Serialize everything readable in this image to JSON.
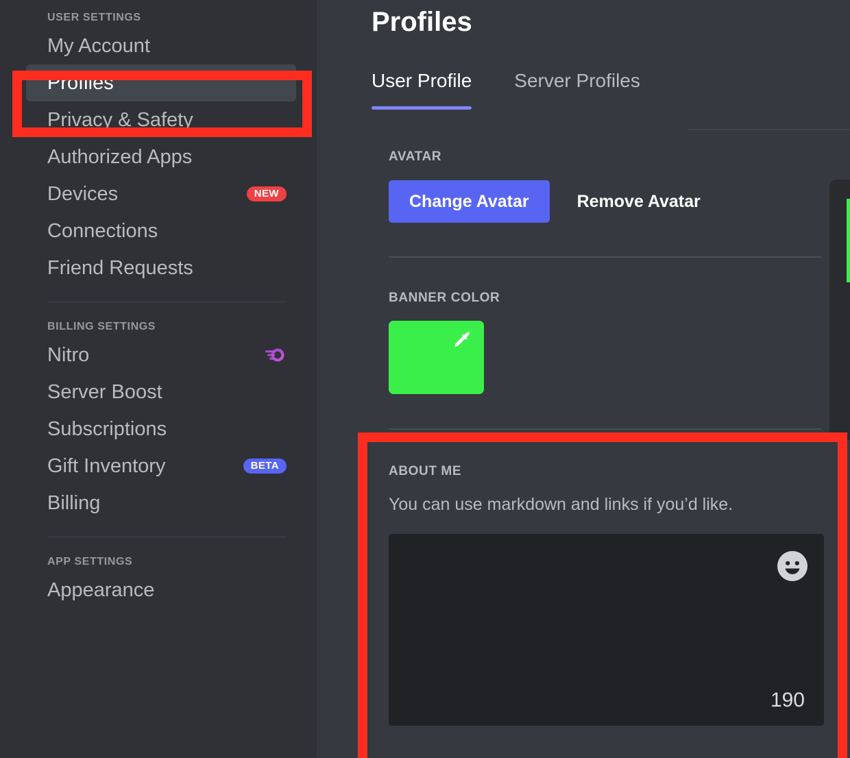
{
  "sidebar": {
    "groups": [
      {
        "header": "USER SETTINGS",
        "items": [
          {
            "label": "My Account",
            "badge": null,
            "icon": null,
            "selected": false
          },
          {
            "label": "Profiles",
            "badge": null,
            "icon": null,
            "selected": true
          },
          {
            "label": "Privacy & Safety",
            "badge": null,
            "icon": null,
            "selected": false
          },
          {
            "label": "Authorized Apps",
            "badge": null,
            "icon": null,
            "selected": false
          },
          {
            "label": "Devices",
            "badge": "NEW",
            "badge_kind": "new",
            "icon": null,
            "selected": false
          },
          {
            "label": "Connections",
            "badge": null,
            "icon": null,
            "selected": false
          },
          {
            "label": "Friend Requests",
            "badge": null,
            "icon": null,
            "selected": false
          }
        ]
      },
      {
        "header": "BILLING SETTINGS",
        "items": [
          {
            "label": "Nitro",
            "badge": null,
            "icon": "nitro-icon",
            "selected": false
          },
          {
            "label": "Server Boost",
            "badge": null,
            "icon": null,
            "selected": false
          },
          {
            "label": "Subscriptions",
            "badge": null,
            "icon": null,
            "selected": false
          },
          {
            "label": "Gift Inventory",
            "badge": "BETA",
            "badge_kind": "beta",
            "icon": null,
            "selected": false
          },
          {
            "label": "Billing",
            "badge": null,
            "icon": null,
            "selected": false
          }
        ]
      },
      {
        "header": "APP SETTINGS",
        "items": [
          {
            "label": "Appearance",
            "badge": null,
            "icon": null,
            "selected": false
          }
        ]
      }
    ]
  },
  "main": {
    "title": "Profiles",
    "tabs": [
      {
        "label": "User Profile",
        "active": true
      },
      {
        "label": "Server Profiles",
        "active": false
      }
    ],
    "avatar": {
      "label": "AVATAR",
      "change_label": "Change Avatar",
      "remove_label": "Remove Avatar"
    },
    "banner": {
      "label": "BANNER COLOR",
      "color": "#3bef4a",
      "picker_icon": "eyedropper-icon"
    },
    "about": {
      "label": "ABOUT ME",
      "description": "You can use markdown and links if you’d like.",
      "textarea_value": "",
      "emoji_icon": "emoji-smiley-icon",
      "char_count": "190"
    }
  },
  "colors": {
    "sidebar_bg": "#2f3136",
    "content_bg": "#36393f",
    "selected_item_bg": "#42464d",
    "accent_blurple": "#5865f2",
    "tab_underline": "#7d86f0",
    "badge_new_red": "#ed4245",
    "badge_beta_blurple": "#5865f2",
    "banner_green": "#3bef4a",
    "textarea_bg": "#202225",
    "annotation_red": "#ff2d20"
  },
  "annotations": [
    {
      "name": "highlight-profiles-nav",
      "target": "Profiles sidebar item"
    },
    {
      "name": "highlight-about-me-section",
      "target": "About Me section"
    }
  ]
}
